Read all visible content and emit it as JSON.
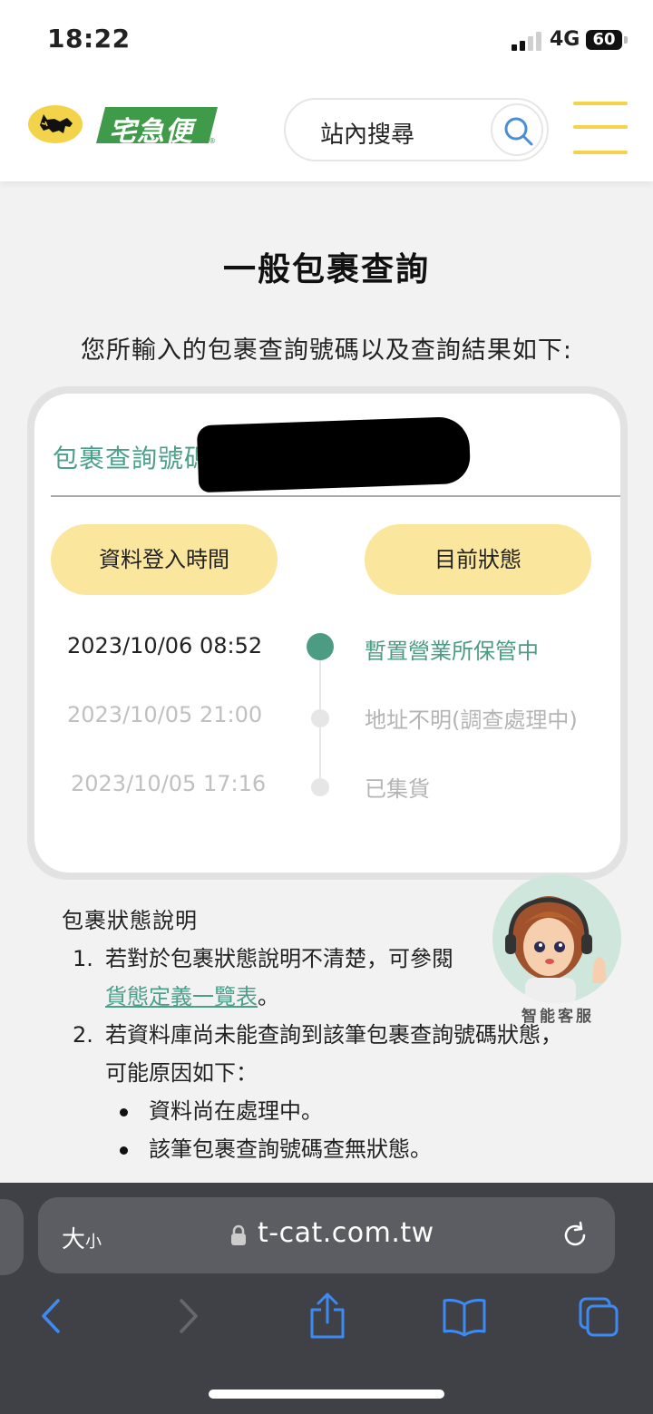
{
  "status_bar": {
    "time": "18:22",
    "network": "4G",
    "battery": "60"
  },
  "header": {
    "brand_text": "宅急便",
    "search_label": "站內搜尋",
    "accent_color": "#f2d34a"
  },
  "page": {
    "title": "一般包裹查詢",
    "intro": "您所輸入的包裹查詢號碼以及查詢結果如下:"
  },
  "result_card": {
    "tracking_label": "包裹查詢號碼",
    "col_time_label": "資料登入時間",
    "col_status_label": "目前狀態",
    "entries": [
      {
        "time": "2023/10/06 08:52",
        "status": "暫置營業所保管中"
      },
      {
        "time": "2023/10/05 21:00",
        "status": "地址不明(調查處理中)"
      },
      {
        "time": "2023/10/05 17:16",
        "status": "已集貨"
      }
    ],
    "active_color": "#4c9c84",
    "pill_color": "#fbe69d"
  },
  "notes": {
    "title": "包裹狀態說明",
    "item1_num": "1.",
    "item1_text": "若對於包裹狀態說明不清楚，可參閱",
    "item1_link": "貨態定義一覽表",
    "item1_end": "。",
    "item2_num": "2.",
    "item2_text": "若資料庫尚未能查詢到該筆包裹查詢號碼狀態，",
    "item2_text_cont": "可能原因如下：",
    "bullets": [
      "資料尚在處理中。",
      "該筆包裹查詢號碼查無狀態。"
    ]
  },
  "assistant": {
    "label": "智能客服"
  },
  "browser": {
    "text_size_big": "大",
    "text_size_small": "小",
    "url": "t-cat.com.tw"
  }
}
